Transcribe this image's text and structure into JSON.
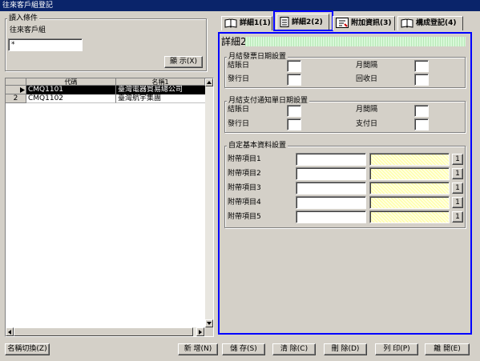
{
  "window": {
    "title": "往來客戶組登記"
  },
  "conditions": {
    "group_label": "讀入條件",
    "field_label": "往來客戶組",
    "field_value": "*",
    "display_button": "顯 示(X)"
  },
  "grid": {
    "columns": [
      "代碼",
      "名稱1"
    ],
    "rows": [
      {
        "num": "",
        "code": "CMQ1101",
        "name": "臺灣電器貿易總公司",
        "selected": true
      },
      {
        "num": "2",
        "code": "CMQ1102",
        "name": "臺灣航宇集團",
        "selected": false
      }
    ]
  },
  "tabs": [
    {
      "label": "詳細1(1)",
      "icon": "book-icon"
    },
    {
      "label": "詳細2(2)",
      "icon": "document-icon",
      "active": true
    },
    {
      "label": "附加資訊(3)",
      "icon": "note-icon"
    },
    {
      "label": "構成登記(4)",
      "icon": "book-icon"
    }
  ],
  "detail": {
    "title": "詳細2",
    "billing_group": {
      "title": "月結發票日期設置",
      "close_day": "結賬日",
      "interval": "月間隔",
      "issue_day": "發行日",
      "collect_day": "回收日"
    },
    "payment_group": {
      "title": "月結支付通知單日期設置",
      "close_day": "結賬日",
      "interval": "月間隔",
      "issue_day": "發行日",
      "pay_day": "支付日"
    },
    "custom_group": {
      "title": "自定基本資料設置",
      "items": [
        "附帶項目1",
        "附帶項目2",
        "附帶項目3",
        "附帶項目4",
        "附帶項目5"
      ],
      "button_label": "1"
    }
  },
  "footer": {
    "name_switch": "名稱切換(Z)",
    "new": "新 增(N)",
    "save": "儲 存(S)",
    "clear": "清 除(C)",
    "delete": "刪 除(D)",
    "print": "列 印(P)",
    "exit": "離 開(E)"
  },
  "colors": {
    "title_bar": "#0a246a",
    "highlight": "#0000ff",
    "selection": "#000080"
  }
}
